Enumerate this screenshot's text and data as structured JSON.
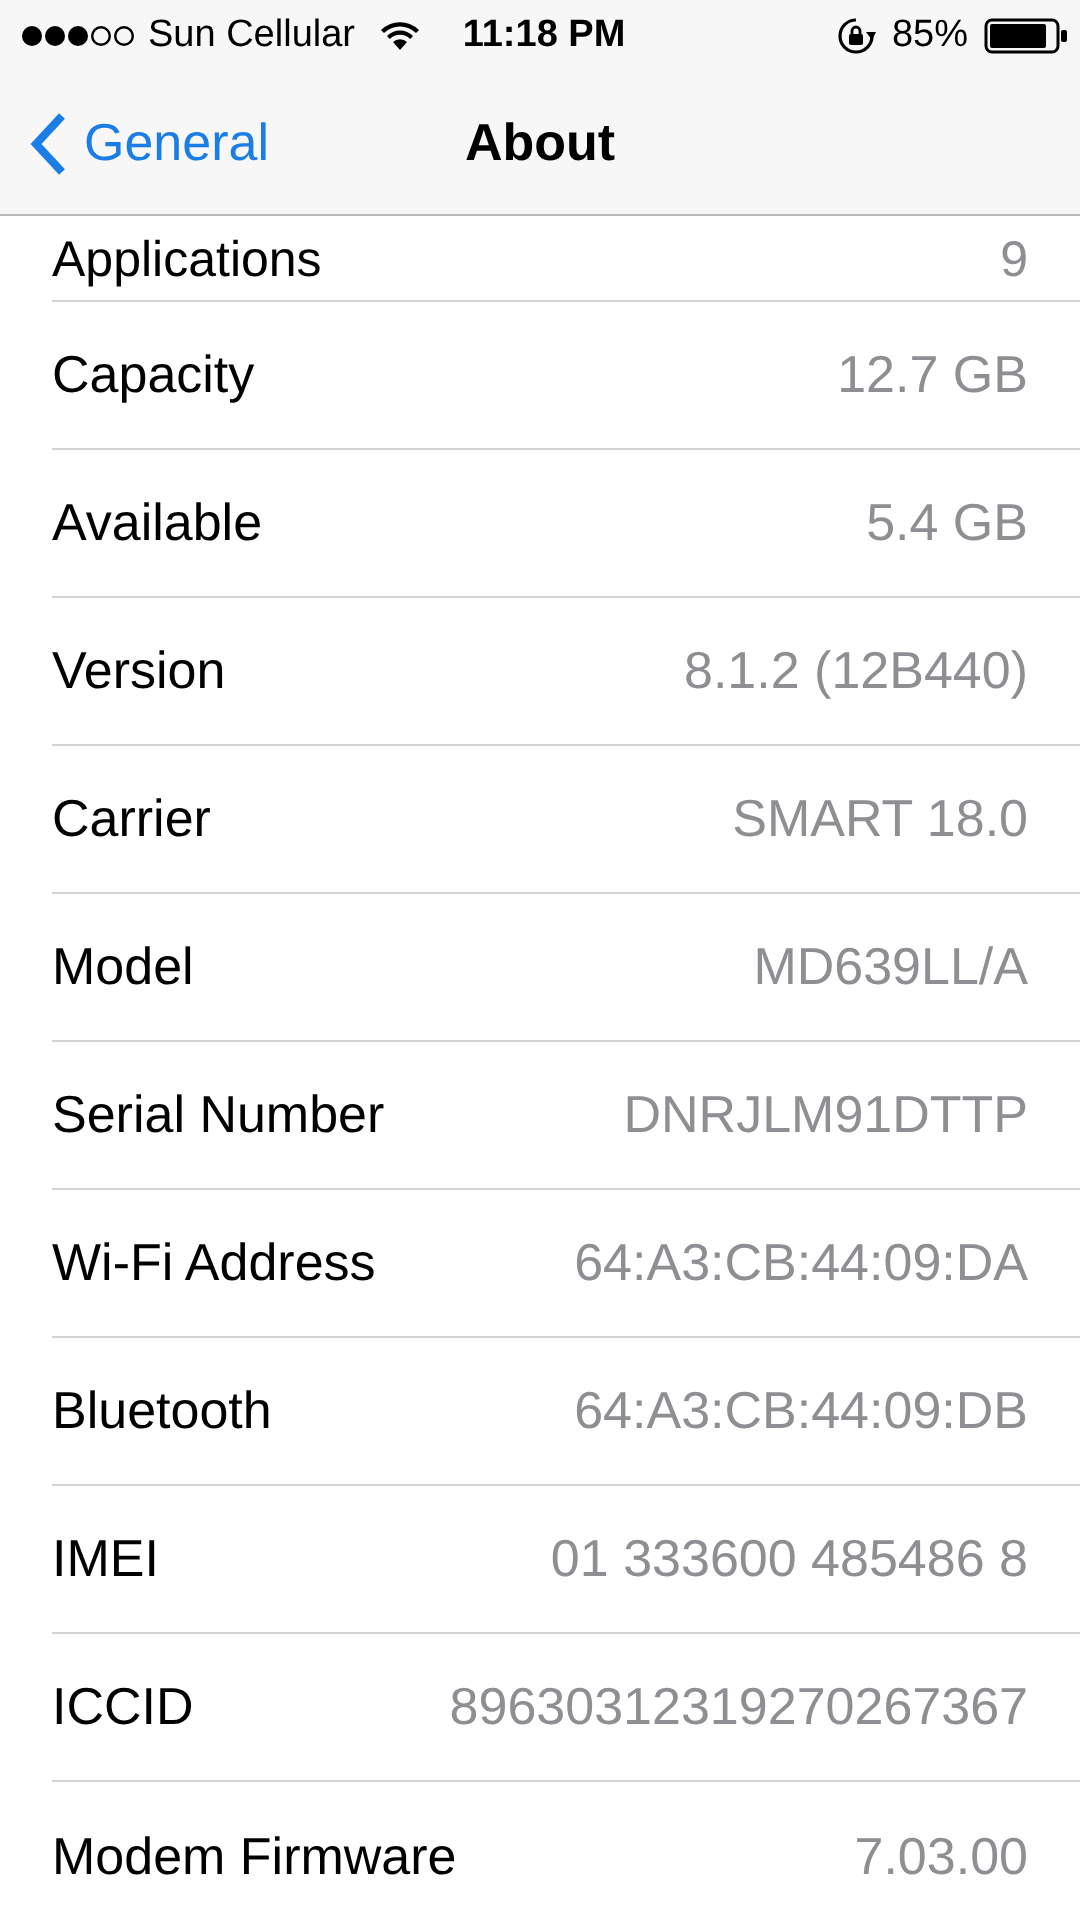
{
  "status_bar": {
    "carrier": "Sun Cellular",
    "time": "11:18 PM",
    "battery": "85%"
  },
  "nav": {
    "back": "General",
    "title": "About"
  },
  "rows": [
    {
      "label": "Applications",
      "value": "9"
    },
    {
      "label": "Capacity",
      "value": "12.7 GB"
    },
    {
      "label": "Available",
      "value": "5.4 GB"
    },
    {
      "label": "Version",
      "value": "8.1.2 (12B440)"
    },
    {
      "label": "Carrier",
      "value": "SMART 18.0"
    },
    {
      "label": "Model",
      "value": "MD639LL/A"
    },
    {
      "label": "Serial Number",
      "value": "DNRJLM91DTTP"
    },
    {
      "label": "Wi-Fi Address",
      "value": "64:A3:CB:44:09:DA"
    },
    {
      "label": "Bluetooth",
      "value": "64:A3:CB:44:09:DB"
    },
    {
      "label": "IMEI",
      "value": "01 333600 485486 8"
    },
    {
      "label": "ICCID",
      "value": "89630312319270267367"
    },
    {
      "label": "Modem Firmware",
      "value": "7.03.00"
    }
  ]
}
